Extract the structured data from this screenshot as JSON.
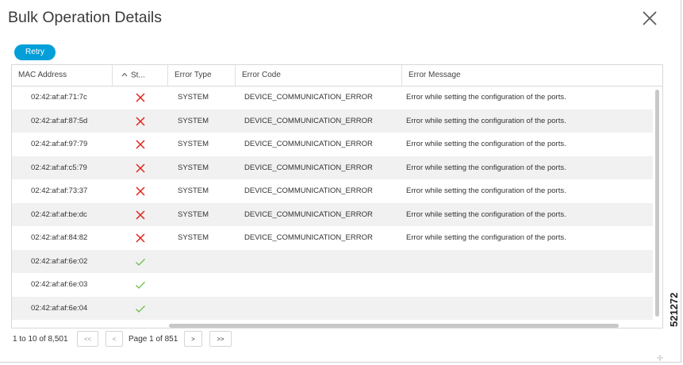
{
  "dialog": {
    "title": "Bulk Operation Details",
    "close_label": "Close",
    "retry_label": "Retry"
  },
  "table": {
    "columns": [
      "MAC Address",
      "St...",
      "Error Type",
      "Error Code",
      "Error Message"
    ],
    "sort_indicator": "^",
    "rows": [
      {
        "mac": "02:42:af:af:71:7c",
        "status": "error",
        "type": "SYSTEM",
        "code": "DEVICE_COMMUNICATION_ERROR",
        "message": "Error while setting the configuration of the ports."
      },
      {
        "mac": "02:42:af:af:87:5d",
        "status": "error",
        "type": "SYSTEM",
        "code": "DEVICE_COMMUNICATION_ERROR",
        "message": "Error while setting the configuration of the ports."
      },
      {
        "mac": "02:42:af:af:97:79",
        "status": "error",
        "type": "SYSTEM",
        "code": "DEVICE_COMMUNICATION_ERROR",
        "message": "Error while setting the configuration of the ports."
      },
      {
        "mac": "02:42:af:af:c5:79",
        "status": "error",
        "type": "SYSTEM",
        "code": "DEVICE_COMMUNICATION_ERROR",
        "message": "Error while setting the configuration of the ports."
      },
      {
        "mac": "02:42:af:af:73:37",
        "status": "error",
        "type": "SYSTEM",
        "code": "DEVICE_COMMUNICATION_ERROR",
        "message": "Error while setting the configuration of the ports."
      },
      {
        "mac": "02:42:af:af:be:dc",
        "status": "error",
        "type": "SYSTEM",
        "code": "DEVICE_COMMUNICATION_ERROR",
        "message": "Error while setting the configuration of the ports."
      },
      {
        "mac": "02:42:af:af:84:82",
        "status": "error",
        "type": "SYSTEM",
        "code": "DEVICE_COMMUNICATION_ERROR",
        "message": "Error while setting the configuration of the ports."
      },
      {
        "mac": "02:42:af:af:6e:02",
        "status": "success",
        "type": "",
        "code": "",
        "message": ""
      },
      {
        "mac": "02:42:af:af:6e:03",
        "status": "success",
        "type": "",
        "code": "",
        "message": ""
      },
      {
        "mac": "02:42:af:af:6e:04",
        "status": "success",
        "type": "",
        "code": "",
        "message": ""
      }
    ]
  },
  "pagination": {
    "range_text": "1 to 10 of 8,501",
    "first_label": "<<",
    "prev_label": "<",
    "page_text": "Page 1 of 851",
    "next_label": ">",
    "last_label": ">>"
  },
  "figure_id": "521272",
  "colors": {
    "accent": "#049fd9",
    "error": "#e2231a",
    "success": "#6cc04a",
    "row_alt": "#f1f1f1"
  },
  "icons": {
    "close": "close-icon",
    "error": "x-icon",
    "success": "check-icon",
    "sort": "sort-ascending-icon",
    "resize": "resize-handle-icon"
  }
}
